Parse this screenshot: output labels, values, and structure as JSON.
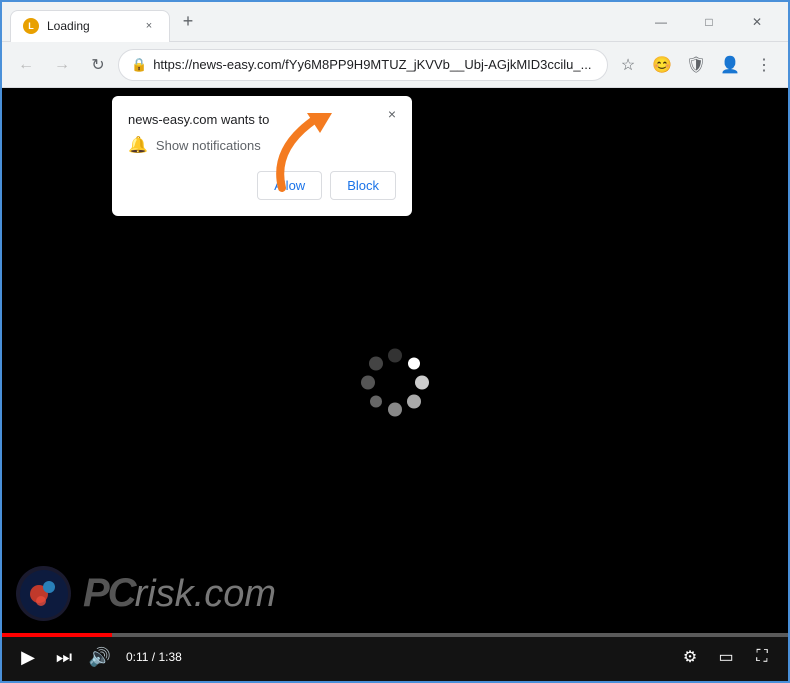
{
  "browser": {
    "tab": {
      "title": "Loading",
      "favicon": "L"
    },
    "new_tab_label": "+",
    "window_controls": {
      "minimize": "—",
      "maximize": "□",
      "close": "✕"
    },
    "address_bar": {
      "url": "https://news-easy.com/fYy6M8PP9H9MTUZ_jKVVb__Ubj-AGjkMID3ccilu_...",
      "lock_icon": "🔒"
    },
    "toolbar": {
      "star": "☆",
      "emoji": "😊",
      "shield": "🛡",
      "profile": "👤",
      "menu": "⋮"
    }
  },
  "nav": {
    "back": "←",
    "forward": "→",
    "reload": "↻"
  },
  "popup": {
    "title": "news-easy.com wants to",
    "close_label": "×",
    "notification_text": "Show notifications",
    "allow_label": "Allow",
    "block_label": "Block"
  },
  "video": {
    "time_current": "0:11",
    "time_total": "1:38",
    "time_display": "0:11 / 1:38",
    "progress_percent": 14
  },
  "watermark": {
    "text": "PC",
    "risk": "risk",
    "domain": ".com"
  },
  "colors": {
    "accent": "#1a73e8",
    "progress_red": "#f00",
    "arrow_orange": "#f47b20"
  }
}
